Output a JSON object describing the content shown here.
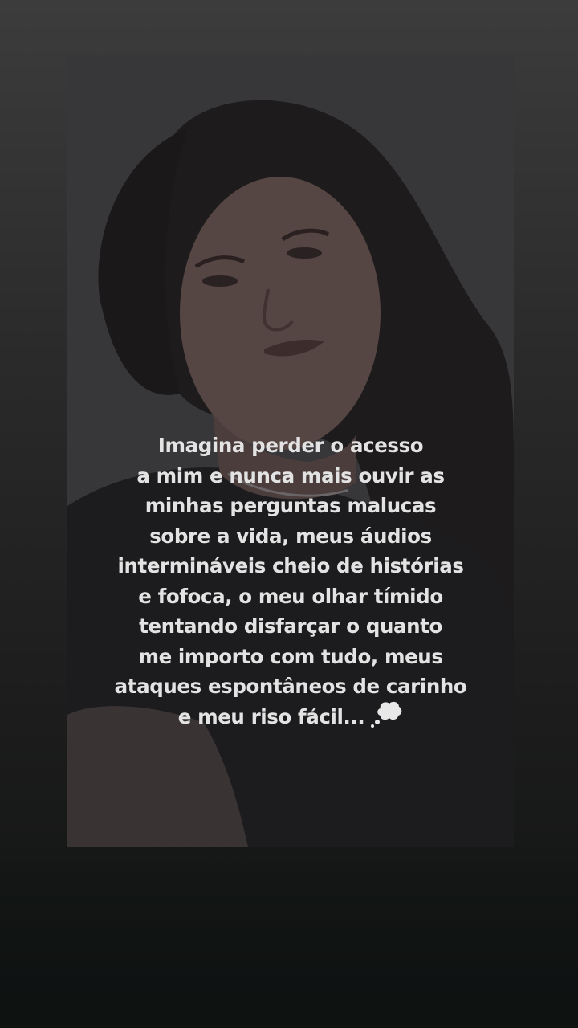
{
  "story": {
    "caption_lines": [
      "Imagina perder o acesso",
      "a mim e nunca mais ouvir as",
      "minhas perguntas malucas",
      "sobre a vida, meus áudios",
      "intermináveis cheio de histórias",
      "e fofoca, o meu olhar tímido",
      "tentando disfarçar o quanto",
      "me importo com tudo, meus",
      "ataques espontâneos de carinho",
      "e meu riso fácil..."
    ],
    "caption_icon": "thought-bubble-icon",
    "colors": {
      "caption_text": "#e3e3e3",
      "background_top": "#3c3c3c",
      "background_bottom": "#0f1312"
    }
  }
}
